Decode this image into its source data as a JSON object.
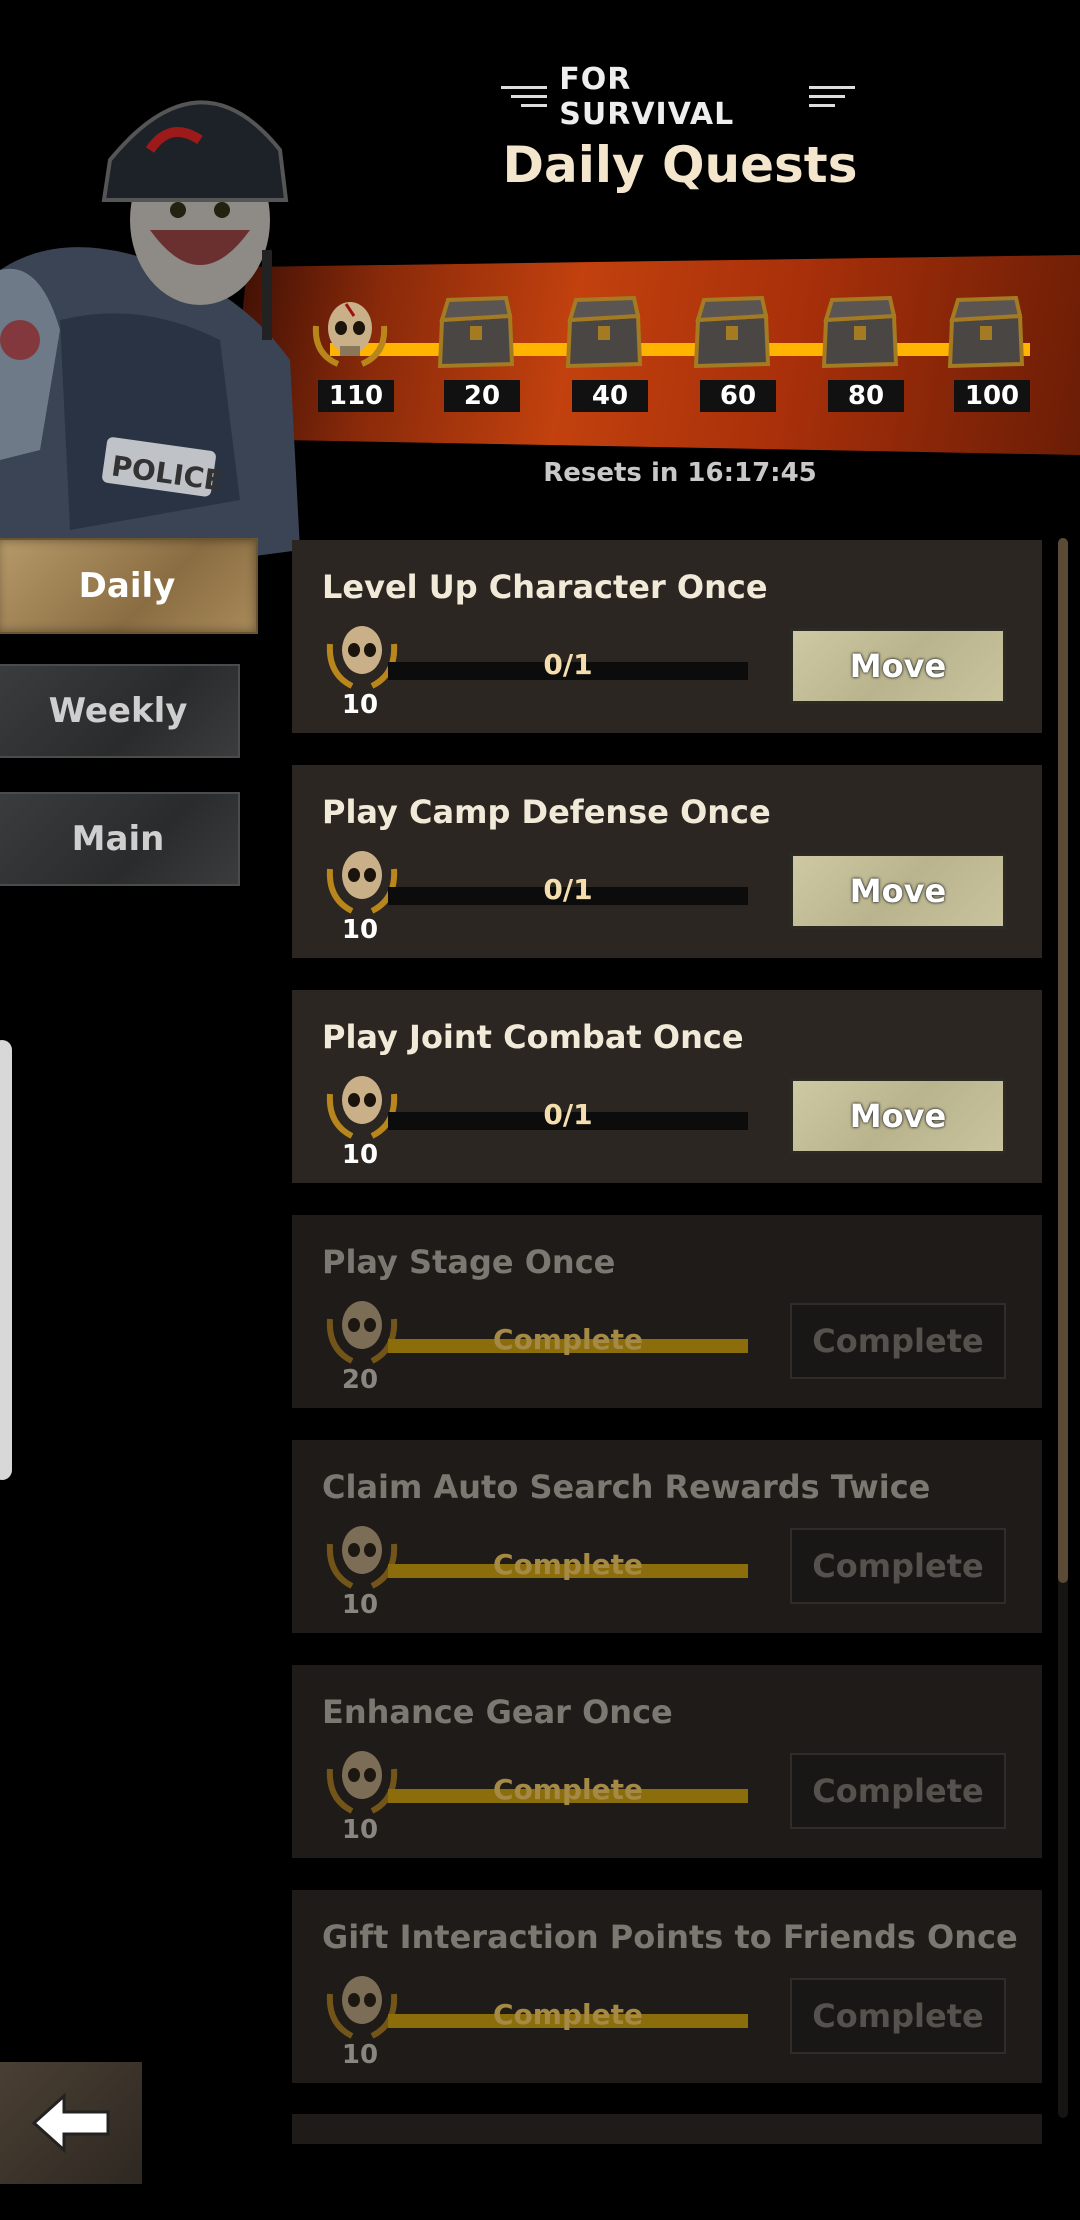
{
  "header": {
    "subtitle": "FOR SURVIVAL",
    "title": "Daily Quests"
  },
  "rewards": {
    "milestones": [
      "110",
      "20",
      "40",
      "60",
      "80",
      "100"
    ],
    "resets": "Resets in 16:17:45",
    "accent_color": "#ffb400"
  },
  "tabs": [
    {
      "label": "Daily",
      "active": true
    },
    {
      "label": "Weekly",
      "active": false
    },
    {
      "label": "Main",
      "active": false
    }
  ],
  "quests": [
    {
      "title": "Level Up Character Once",
      "progress": "0/1",
      "reward": "10",
      "button": "Move",
      "done": false
    },
    {
      "title": "Play Camp Defense Once",
      "progress": "0/1",
      "reward": "10",
      "button": "Move",
      "done": false
    },
    {
      "title": "Play Joint Combat Once",
      "progress": "0/1",
      "reward": "10",
      "button": "Move",
      "done": false
    },
    {
      "title": "Play Stage Once",
      "progress": "Complete",
      "reward": "20",
      "button": "Complete",
      "done": true
    },
    {
      "title": "Claim Auto Search Rewards Twice",
      "progress": "Complete",
      "reward": "10",
      "button": "Complete",
      "done": true
    },
    {
      "title": "Enhance Gear Once",
      "progress": "Complete",
      "reward": "10",
      "button": "Complete",
      "done": true
    },
    {
      "title": "Gift Interaction Points to Friends Once",
      "progress": "Complete",
      "reward": "10",
      "button": "Complete",
      "done": true
    }
  ],
  "icons": {
    "back": "back-arrow-icon",
    "skull": "skull-laurel-icon",
    "chest": "treasure-chest-icon",
    "character": "zombie-police-character"
  }
}
